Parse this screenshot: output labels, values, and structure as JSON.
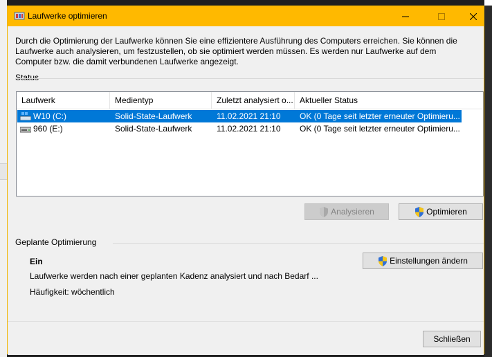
{
  "window": {
    "title": "Laufwerke optimieren"
  },
  "intro_text": "Durch die Optimierung der Laufwerke können Sie eine effizientere Ausführung des Computers erreichen. Sie können die Laufwerke auch analysieren, um festzustellen, ob sie optimiert werden müssen. Es werden nur Laufwerke auf dem Computer bzw. die damit verbundenen Laufwerke angezeigt.",
  "status": {
    "label": "Status",
    "columns": [
      "Laufwerk",
      "Medientyp",
      "Zuletzt analysiert o...",
      "Aktueller Status"
    ],
    "rows": [
      {
        "drive": "W10 (C:)",
        "media": "Solid-State-Laufwerk",
        "last": "11.02.2021 21:10",
        "state": "OK (0 Tage seit letzter erneuter Optimieru...",
        "selected": true,
        "icon": "windows-drive-icon"
      },
      {
        "drive": "960 (E:)",
        "media": "Solid-State-Laufwerk",
        "last": "11.02.2021 21:10",
        "state": "OK (0 Tage seit letzter erneuter Optimieru...",
        "selected": false,
        "icon": "drive-icon"
      }
    ]
  },
  "buttons": {
    "analyze": "Analysieren",
    "optimize": "Optimieren",
    "change_settings": "Einstellungen ändern",
    "close": "Schließen"
  },
  "scheduled": {
    "label": "Geplante Optimierung",
    "state": "Ein",
    "description": "Laufwerke werden nach einer geplanten Kadenz analysiert und nach Bedarf ...",
    "frequency": "Häufigkeit: wöchentlich"
  },
  "colors": {
    "titlebar": "#ffb900",
    "selection": "#0078d7"
  }
}
